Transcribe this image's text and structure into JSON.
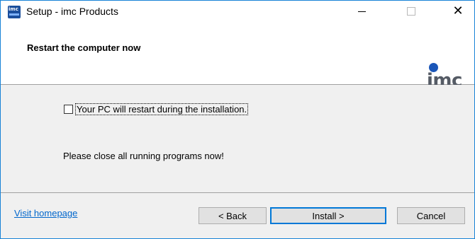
{
  "window": {
    "title": "Setup - imc Products",
    "icon_name": "imc-studio-app-icon",
    "icon_text": "imc"
  },
  "window_controls": {
    "minimize_icon": "minimize-icon",
    "maximize_icon": "maximize-icon",
    "close_icon": "close-icon",
    "close_glyph": "✕"
  },
  "header": {
    "title": "Restart the computer now",
    "logo_text": "imc",
    "logo_color": "#1a56b8"
  },
  "content": {
    "checkbox": {
      "label": "Your PC will restart during the installation.",
      "checked": false
    },
    "message": "Please close all running programs now!"
  },
  "footer": {
    "homepage_link": "Visit homepage",
    "back_label": "< Back",
    "install_label": "Install >",
    "cancel_label": "Cancel"
  },
  "colors": {
    "accent": "#0078d7",
    "link": "#0066cc"
  }
}
